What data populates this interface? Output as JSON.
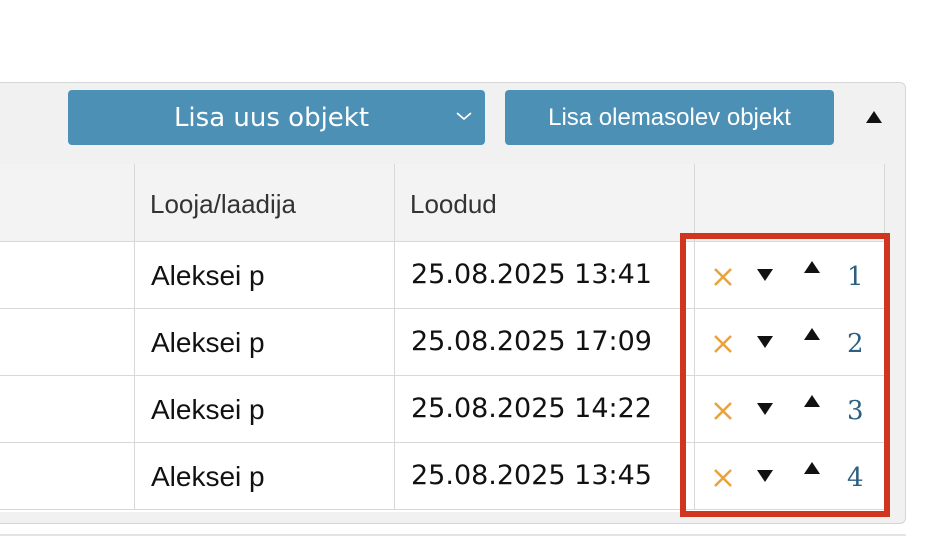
{
  "toolbar": {
    "add_new_label": "Lisa uus objekt",
    "add_existing_label": "Lisa olemasolev objekt"
  },
  "table": {
    "headers": [
      "",
      "Looja/laadija",
      "Loodud",
      ""
    ],
    "rows": [
      {
        "creator": "Aleksei p",
        "created": "25.08.2025 13:41",
        "order": "1"
      },
      {
        "creator": "Aleksei p",
        "created": "25.08.2025 17:09",
        "order": "2"
      },
      {
        "creator": "Aleksei p",
        "created": "25.08.2025 14:22",
        "order": "3"
      },
      {
        "creator": "Aleksei p",
        "created": "25.08.2025 13:45",
        "order": "4"
      }
    ]
  },
  "icons": {
    "delete": "close-icon",
    "move_down": "triangle-down-icon",
    "move_up": "triangle-up-icon",
    "collapse": "triangle-up-icon",
    "dropdown": "chevron-down-icon"
  },
  "colors": {
    "button_bg": "#4d90b5",
    "delete_icon": "#e8a33c",
    "link": "#2c5f82",
    "highlight": "#d0361f"
  }
}
